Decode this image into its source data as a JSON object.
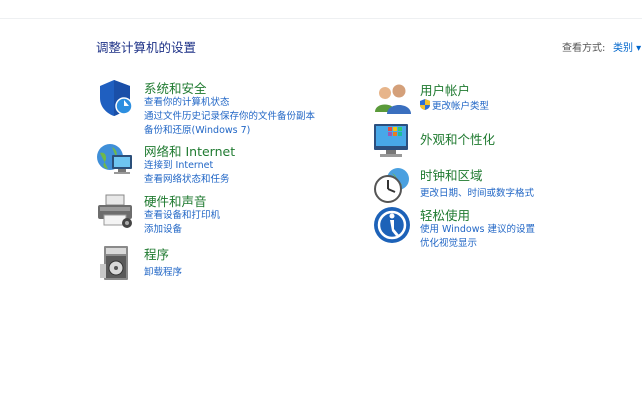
{
  "page": {
    "title": "调整计算机的设置"
  },
  "view": {
    "label": "查看方式:",
    "value": "类别 ▾"
  },
  "left_categories": [
    {
      "title": "系统和安全",
      "icon": "system-security-icon",
      "links": [
        "查看你的计算机状态",
        "通过文件历史记录保存你的文件备份副本",
        "备份和还原(Windows 7)"
      ]
    },
    {
      "title": "网络和 Internet",
      "icon": "network-icon",
      "links": [
        "连接到 Internet",
        "查看网络状态和任务"
      ]
    },
    {
      "title": "硬件和声音",
      "icon": "hardware-sound-icon",
      "links": [
        "查看设备和打印机",
        "添加设备"
      ]
    },
    {
      "title": "程序",
      "icon": "programs-icon",
      "links": [
        "卸载程序"
      ]
    }
  ],
  "right_categories": [
    {
      "title": "用户帐户",
      "icon": "user-accounts-icon",
      "links": [
        "更改帐户类型"
      ]
    },
    {
      "title": "外观和个性化",
      "icon": "appearance-icon",
      "links": []
    },
    {
      "title": "时钟和区域",
      "icon": "clock-region-icon",
      "links": [
        "更改日期、时间或数字格式"
      ]
    },
    {
      "title": "轻松使用",
      "icon": "ease-of-access-icon",
      "links": [
        "使用 Windows 建议的设置",
        "优化视觉显示"
      ]
    }
  ],
  "colors": {
    "title": "#1e3287",
    "category": "#1f7a30",
    "link": "#2267c6"
  }
}
